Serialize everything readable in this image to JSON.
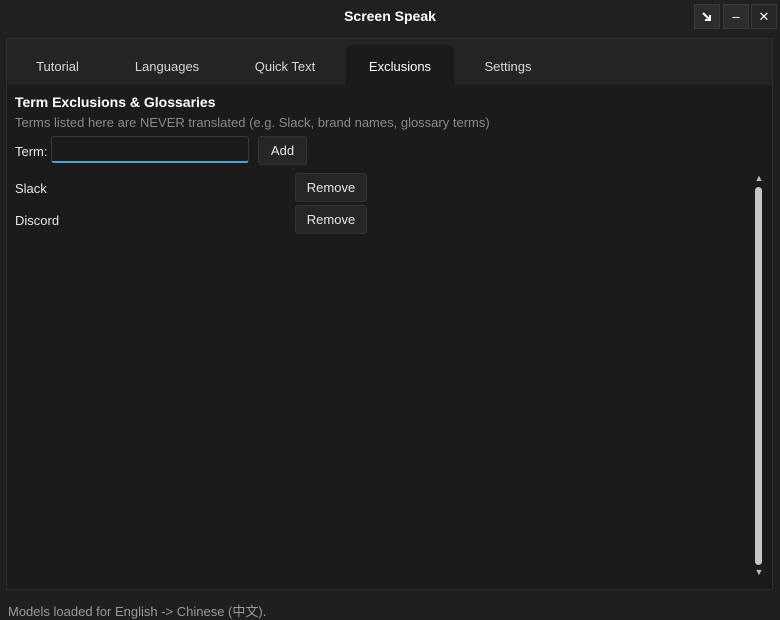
{
  "window": {
    "title": "Screen Speak",
    "controls": {
      "restore_icon": "arrow-down-right-icon",
      "minimize_symbol": "–",
      "close_symbol": "✕"
    }
  },
  "tabs": [
    {
      "label": "Tutorial"
    },
    {
      "label": "Languages"
    },
    {
      "label": "Quick Text"
    },
    {
      "label": "Exclusions",
      "active": true
    },
    {
      "label": "Settings"
    }
  ],
  "exclusions": {
    "heading": "Term Exclusions & Glossaries",
    "description": "Terms listed here are NEVER translated (e.g. Slack, brand names, glossary terms)",
    "term_label": "Term:",
    "term_value": "",
    "add_label": "Add",
    "terms": [
      {
        "term": "Slack",
        "remove_label": "Remove"
      },
      {
        "term": "Discord",
        "remove_label": "Remove"
      }
    ]
  },
  "status": "Models loaded for English -> Chinese (中文).",
  "colors": {
    "accent": "#4fa3d9",
    "background": "#1b1b1b"
  }
}
